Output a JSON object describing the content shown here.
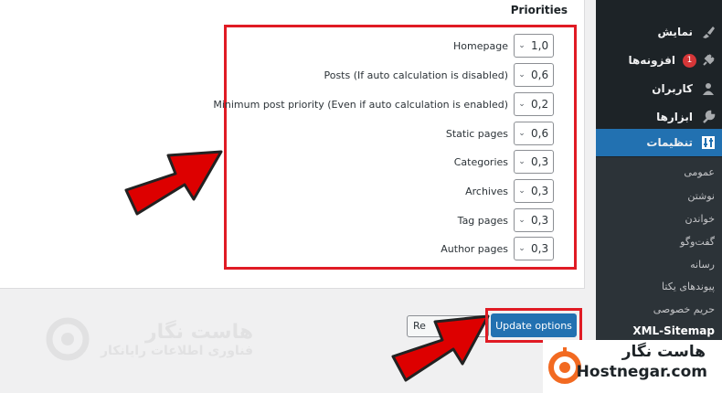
{
  "panel": {
    "title": "Priorities"
  },
  "priorities": [
    {
      "label": "Homepage",
      "value": "1,0"
    },
    {
      "label": "Posts (If auto calculation is disabled)",
      "value": "0,6"
    },
    {
      "label": "Minimum post priority (Even if auto calculation is enabled)",
      "value": "0,2"
    },
    {
      "label": "Static pages",
      "value": "0,6"
    },
    {
      "label": "Categories",
      "value": "0,3"
    },
    {
      "label": "Archives",
      "value": "0,3"
    },
    {
      "label": "Tag pages",
      "value": "0,3"
    },
    {
      "label": "Author pages",
      "value": "0,3"
    }
  ],
  "actions": {
    "reset_label": "Re",
    "update_label": "Update options"
  },
  "sidebar": {
    "menu": [
      {
        "label": "نمایش",
        "icon": "paintbrush-icon"
      },
      {
        "label": "افزونه‌ها",
        "icon": "plugin-icon",
        "badge": "1"
      },
      {
        "label": "کاربران",
        "icon": "users-icon"
      },
      {
        "label": "ابزارها",
        "icon": "wrench-icon"
      },
      {
        "label": "تنظیمات",
        "icon": "settings-icon"
      }
    ],
    "submenu": [
      "عمومی",
      "نوشتن",
      "خواندن",
      "گفت‌وگو",
      "رسانه",
      "پیوندهای یکتا",
      "حریم خصوصی",
      "XML-Sitemap"
    ]
  },
  "watermark": {
    "line1": "هاست نگار",
    "line2": "فناوری اطلاعات رایانکار"
  },
  "logo": {
    "line1": "هاست نگار",
    "line2": "Hostnegar.com"
  },
  "colors": {
    "accent": "#2271b1",
    "highlight": "#e01b24",
    "sidebar": "#1d2327",
    "logo_orange": "#f26a21"
  }
}
